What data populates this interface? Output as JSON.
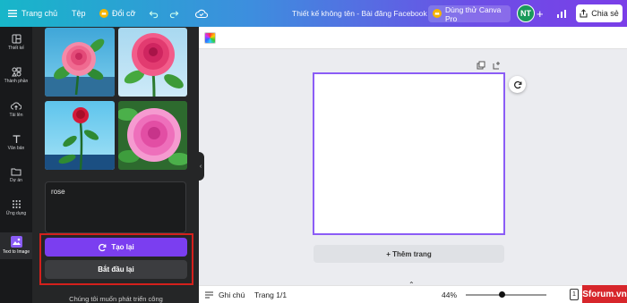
{
  "topbar": {
    "home_label": "Trang chủ",
    "file_label": "Tệp",
    "resize_label": "Đổi cỡ",
    "doc_title": "Thiết kế không tên - Bài đăng Facebook",
    "pro_label": "Dùng thử Canva Pro",
    "avatar_initials": "NT",
    "share_label": "Chia sẻ"
  },
  "rail": {
    "items": [
      {
        "label": "Thiết kế",
        "icon": "layout-icon"
      },
      {
        "label": "Thành phần",
        "icon": "elements-icon"
      },
      {
        "label": "Tải lên",
        "icon": "upload-icon"
      },
      {
        "label": "Văn bản",
        "icon": "text-icon"
      },
      {
        "label": "Dự án",
        "icon": "folder-icon"
      },
      {
        "label": "Ứng dụng",
        "icon": "apps-icon"
      },
      {
        "label": "Text to Image",
        "icon": "text-to-image-icon"
      }
    ]
  },
  "panel": {
    "prompt_text": "rose",
    "regenerate_label": "Tạo lại",
    "restart_label": "Bắt đầu lại",
    "footer_text": "Chúng tôi muốn phát triển công"
  },
  "canvas": {
    "add_page_label": "+ Thêm trang"
  },
  "bottombar": {
    "notes_label": "Ghi chú",
    "page_label": "Trang 1/1",
    "zoom_label": "44%",
    "page_count": "1"
  },
  "watermark": {
    "text": "Sforum.vn"
  },
  "colors": {
    "accent": "#7b3ef0",
    "highlight_border": "#d4201c",
    "panel_bg": "#252627",
    "rail_bg": "#18191b"
  }
}
